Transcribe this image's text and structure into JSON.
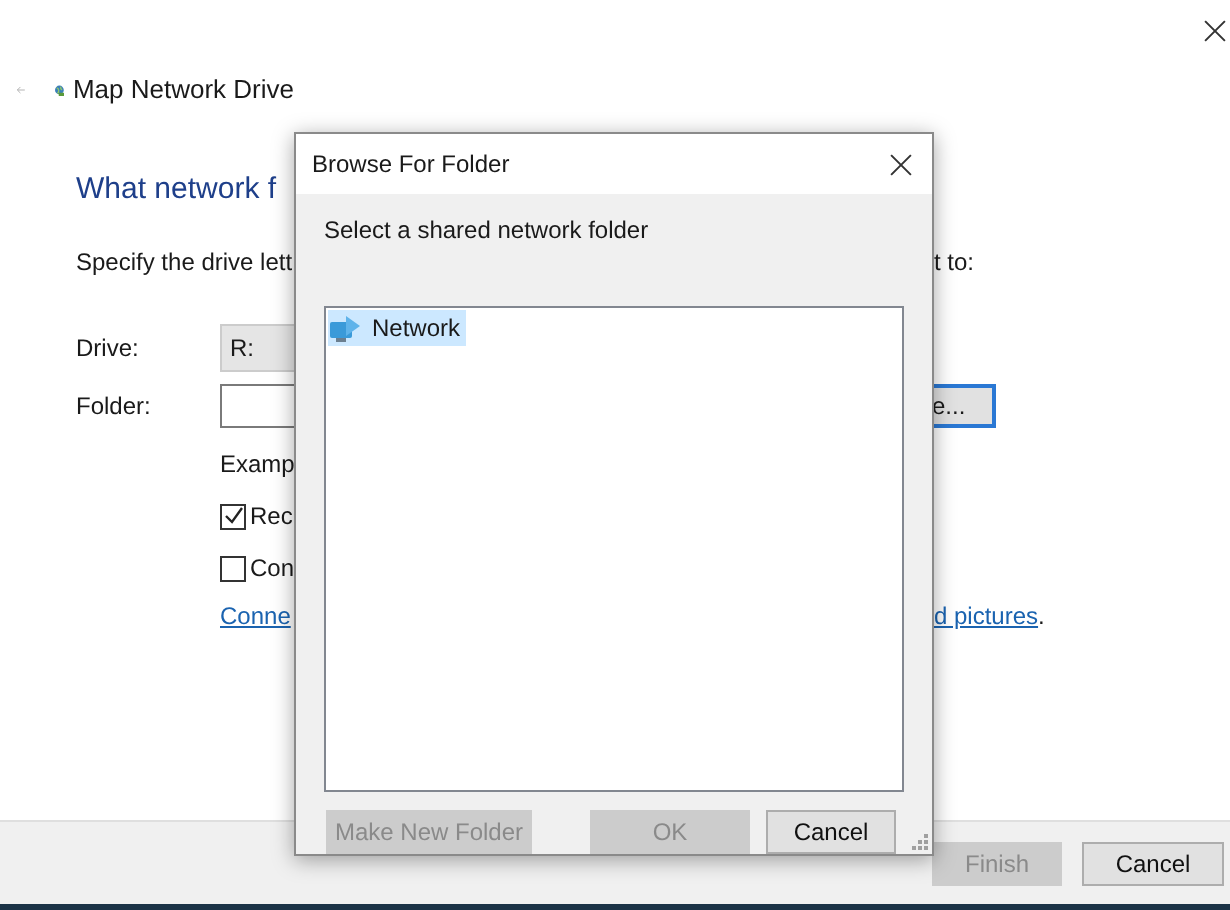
{
  "wizard": {
    "title": "Map Network Drive",
    "heading": "What network f",
    "instruction": "Specify the drive lett",
    "instruction_end": "t to:",
    "drive_label": "Drive:",
    "drive_value": "R:",
    "folder_label": "Folder:",
    "browse_button": "e...",
    "example": "Examp",
    "options": [
      {
        "label": "Rec",
        "checked": true
      },
      {
        "label": "Con",
        "checked": false
      }
    ],
    "link": "Conne",
    "link_end": "d pictures",
    "link_period": ".",
    "buttons": [
      {
        "label": "Finish",
        "disabled": true
      },
      {
        "label": "Cancel",
        "disabled": false
      }
    ]
  },
  "dialog": {
    "title": "Browse For Folder",
    "prompt": "Select a shared network folder",
    "tree": [
      {
        "label": "Network",
        "selected": true
      }
    ],
    "buttons": [
      {
        "label": "Make New Folder",
        "disabled": true
      },
      {
        "label": "OK",
        "disabled": true
      },
      {
        "label": "Cancel",
        "disabled": false
      }
    ]
  }
}
